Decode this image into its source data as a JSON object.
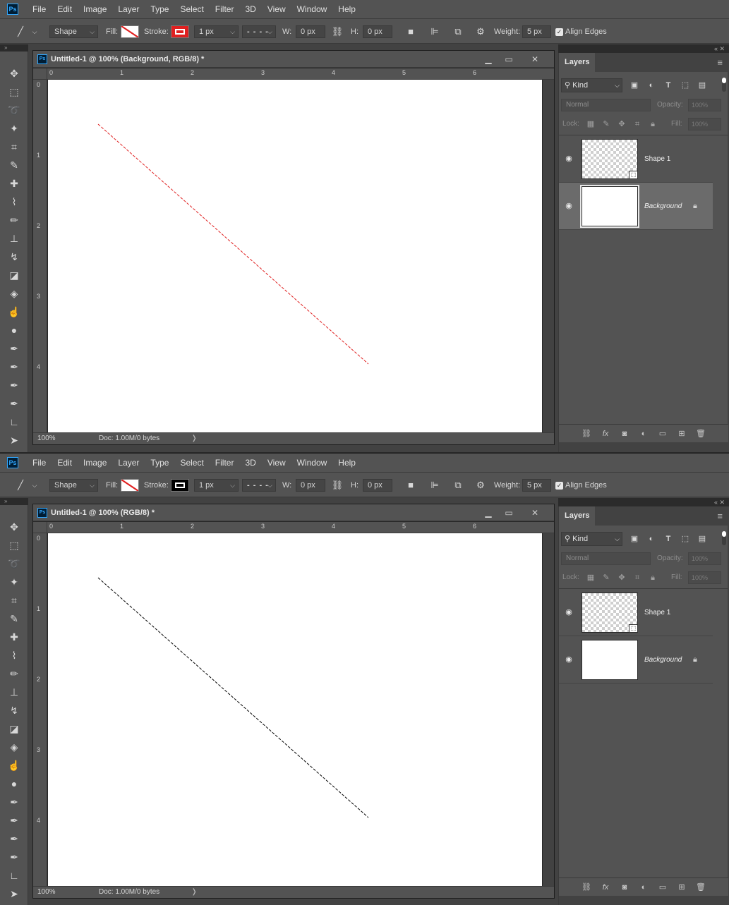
{
  "menu": [
    "File",
    "Edit",
    "Image",
    "Layer",
    "Type",
    "Select",
    "Filter",
    "3D",
    "View",
    "Window",
    "Help"
  ],
  "app_logo": "Ps",
  "options": {
    "mode": "Shape",
    "fill_label": "Fill:",
    "stroke_label": "Stroke:",
    "stroke_width": "1 px",
    "w_label": "W:",
    "w_value": "0 px",
    "h_label": "H:",
    "h_value": "0 px",
    "weight_label": "Weight:",
    "weight_value": "5 px",
    "align_edges": "Align Edges"
  },
  "screens": [
    {
      "doc_title": "Untitled-1 @ 100% (Background, RGB/8) *",
      "stroke_color": "#e02020",
      "line_color": "#e02020",
      "selected_layer": "Background"
    },
    {
      "doc_title": "Untitled-1 @ 100% (RGB/8) *",
      "stroke_color": "#000000",
      "line_color": "#000000",
      "selected_layer": ""
    }
  ],
  "ruler": {
    "h_marks": [
      "0",
      "1",
      "2",
      "3",
      "4",
      "5",
      "6"
    ],
    "v_marks": [
      "0",
      "1",
      "2",
      "3",
      "4"
    ]
  },
  "status": {
    "zoom": "100%",
    "doc_info": "Doc: 1.00M/0 bytes"
  },
  "layers_panel": {
    "tab": "Layers",
    "kind": "Kind",
    "blend_mode": "Normal",
    "opacity_label": "Opacity:",
    "opacity_value": "100%",
    "lock_label": "Lock:",
    "fill_label": "Fill:",
    "fill_value": "100%",
    "layers": [
      {
        "name": "Shape 1",
        "type": "shape"
      },
      {
        "name": "Background",
        "type": "background"
      }
    ]
  },
  "colors": {
    "accent": "#31a8ff",
    "panel": "#535353",
    "dark": "#424242",
    "selected_row": "#6b6b6b"
  }
}
